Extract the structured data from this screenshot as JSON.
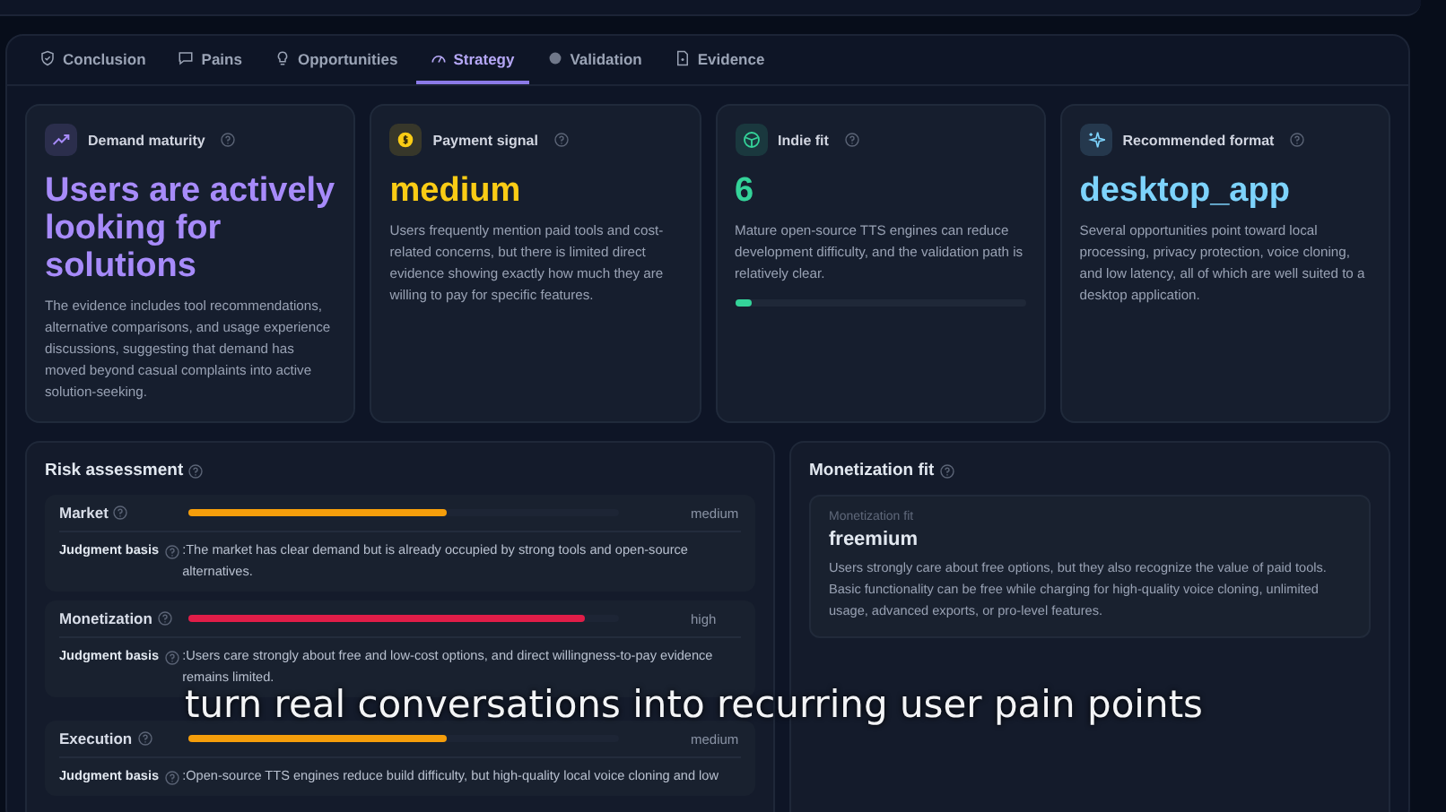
{
  "tabs": [
    {
      "label": "Conclusion",
      "selected": false
    },
    {
      "label": "Pains",
      "selected": false
    },
    {
      "label": "Opportunities",
      "selected": false
    },
    {
      "label": "Strategy",
      "selected": true
    },
    {
      "label": "Validation",
      "selected": false
    },
    {
      "label": "Evidence",
      "selected": false
    }
  ],
  "metrics": [
    {
      "label": "Demand maturity",
      "color": "#a78bfa",
      "value": "Users are actively looking for solutions",
      "description": "The evidence includes tool recommendations, alternative comparisons, and usage experience discussions, suggesting that demand has moved beyond casual complaints into active solution-seeking."
    },
    {
      "label": "Payment signal",
      "color": "#facc15",
      "value": "medium",
      "description": "Users frequently mention paid tools and cost-related concerns, but there is limited direct evidence showing exactly how much they are willing to pay for specific features."
    },
    {
      "label": "Indie fit",
      "color": "#34d399",
      "value": "6",
      "description": "Mature open-source TTS engines can reduce development difficulty, and the validation path is relatively clear.",
      "level": 0.06
    },
    {
      "label": "Recommended format",
      "color": "#7dd3fc",
      "value": "desktop_app",
      "description": "Several opportunities point toward local processing, privacy protection, voice cloning, and low latency, all of which are well suited to a desktop application."
    }
  ],
  "risk_assessment": {
    "title": "Risk assessment",
    "items": [
      {
        "name": "Market",
        "level": 0.6,
        "color": "#f59e0b",
        "rating": "medium",
        "basis_label": "Judgment basis",
        "basis": ":The market has clear demand but is already occupied by strong tools and open-source alternatives."
      },
      {
        "name": "Monetization",
        "level": 0.92,
        "color": "#e11d48",
        "rating": "high",
        "basis_label": "Judgment basis",
        "basis": ":Users care strongly about free and low-cost options, and direct willingness-to-pay evidence remains limited."
      },
      {
        "name": "Execution",
        "level": 0.6,
        "color": "#f59e0b",
        "rating": "medium",
        "basis_label": "Judgment basis",
        "basis": ":Open-source TTS engines reduce build difficulty, but high-quality local voice cloning and low"
      }
    ]
  },
  "monetization_fit": {
    "title": "Monetization fit",
    "caption": "Monetization fit",
    "model": "freemium",
    "description": "Users strongly care about free options, but they also recognize the value of paid tools. Basic functionality can be free while charging for high-quality voice cloning, unlimited usage, advanced exports, or pro-level features."
  },
  "subtitle": "turn real conversations into recurring user pain points"
}
